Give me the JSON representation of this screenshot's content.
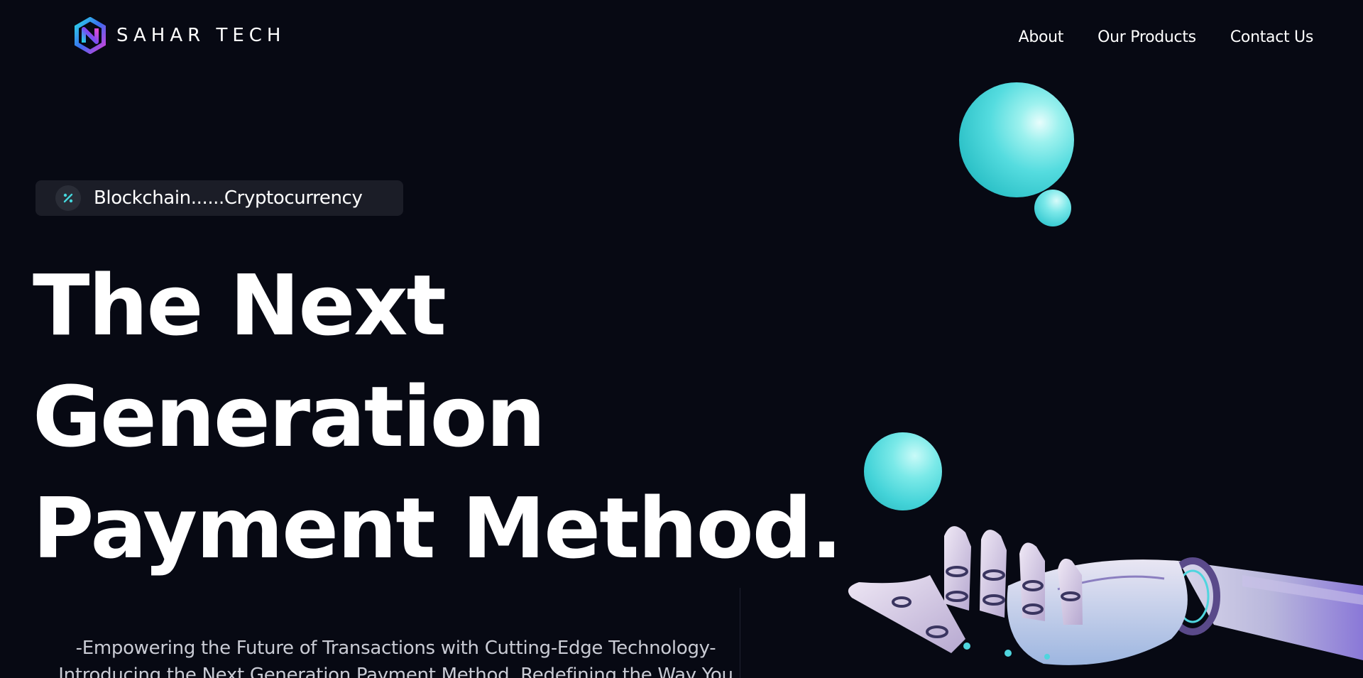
{
  "brand": {
    "name": "SAHAR TECH"
  },
  "nav": {
    "items": [
      {
        "label": "About"
      },
      {
        "label": "Our Products"
      },
      {
        "label": "Contact Us"
      }
    ]
  },
  "hero": {
    "badge_text": "Blockchain......Cryptocurrency",
    "badge_icon": "percent-icon",
    "headline_lines": [
      "The Next",
      "Generation",
      "Payment Method."
    ],
    "subtitle_lines": [
      "-Empowering the Future of Transactions with Cutting-Edge Technology-",
      "Introducing the Next Generation Payment Method, Redefining the Way You"
    ]
  },
  "colors": {
    "background": "#070913",
    "accent_cyan": "#45d6db",
    "badge_bg": "#1b1d27",
    "text_primary": "#ffffff",
    "text_secondary": "#c9cbd4"
  },
  "illustrations": [
    "cyan-sphere-icon",
    "robot-hand-icon"
  ]
}
